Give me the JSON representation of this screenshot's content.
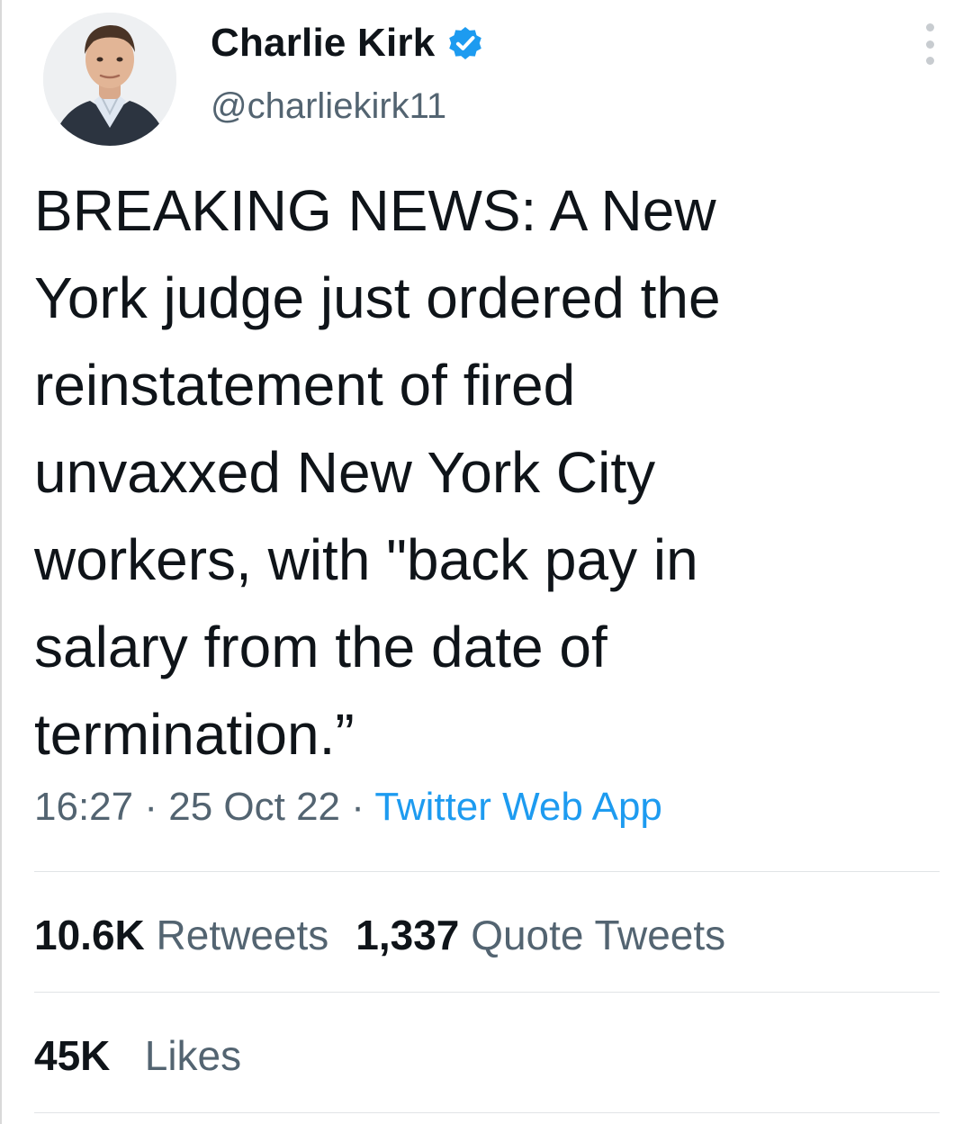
{
  "author": {
    "display_name": "Charlie Kirk",
    "handle": "@charliekirk11",
    "verified": true,
    "avatar_icon": "profile-photo",
    "verified_icon": "verified-badge-icon",
    "more_icon": "more-options-icon"
  },
  "tweet": {
    "text": "BREAKING NEWS: A New\nYork judge just ordered the\nreinstatement of fired\nunvaxxed New York City\nworkers, with \"back pay in\nsalary from the date of\ntermination.”",
    "time": "16:27",
    "separator": "·",
    "date": "25 Oct 22",
    "source": "Twitter Web App"
  },
  "stats": {
    "retweets_count": "10.6K",
    "retweets_label": "Retweets",
    "quotes_count": "1,337",
    "quotes_label": "Quote Tweets",
    "likes_count": "45K",
    "likes_label": "Likes"
  },
  "colors": {
    "text": "#0f1419",
    "secondary": "#536471",
    "link": "#1d9bf0",
    "verified": "#1d9bf0",
    "divider": "#e1e4e6"
  }
}
